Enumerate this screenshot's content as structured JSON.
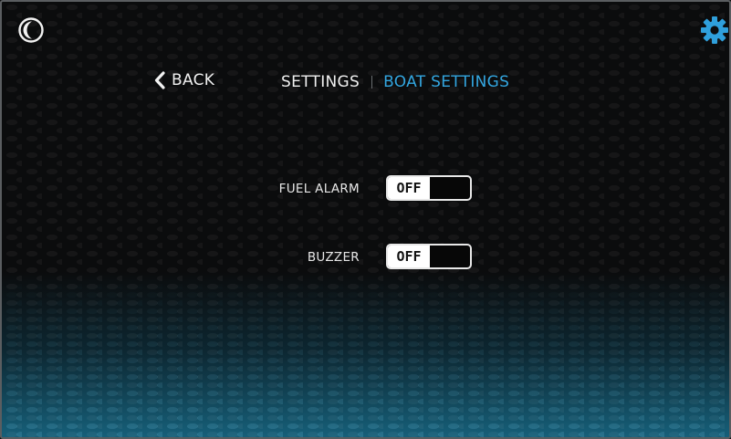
{
  "nav": {
    "back_label": "BACK",
    "breadcrumb_parent": "SETTINGS",
    "breadcrumb_current": "BOAT SETTINGS"
  },
  "settings": [
    {
      "label": "FUEL ALARM",
      "state": "OFF"
    },
    {
      "label": "BUZZER",
      "state": "OFF"
    }
  ],
  "icons": {
    "top_left": "moon-icon",
    "top_right": "gear-icon"
  },
  "colors": {
    "accent": "#33a6e0",
    "text": "#f0f0f0",
    "background": "#0b0c0d"
  }
}
